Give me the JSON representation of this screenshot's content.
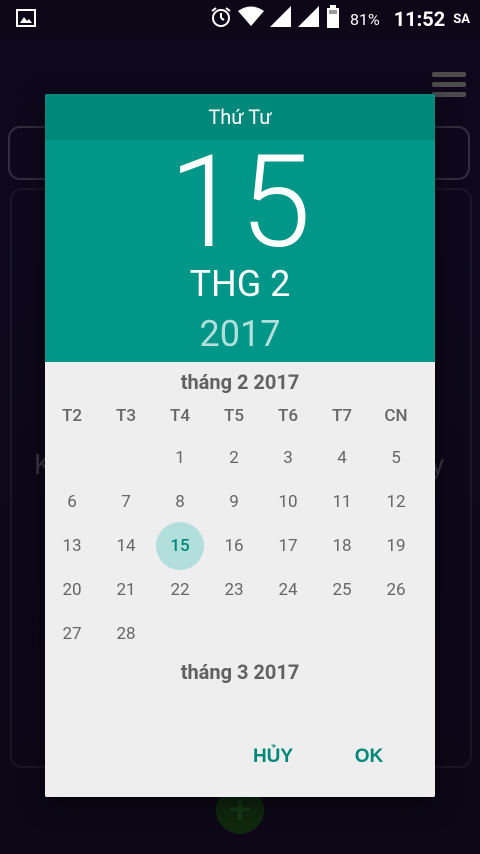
{
  "status_bar": {
    "battery": "81%",
    "time": "11:52",
    "ampm": "SA",
    "icons": [
      "image-icon",
      "alarm-icon",
      "wifi-icon",
      "signal-icon",
      "signal-icon",
      "battery-icon"
    ]
  },
  "background_app": {
    "peek_left": "K",
    "peek_right": "y",
    "fab_label": "+"
  },
  "dialog": {
    "weekday": "Thứ Tư",
    "day": "15",
    "month": "THG 2",
    "year": "2017",
    "month_title": "tháng 2 2017",
    "next_month_title": "tháng 3 2017",
    "weekday_headers": [
      "T2",
      "T3",
      "T4",
      "T5",
      "T6",
      "T7",
      "CN"
    ],
    "first_weekday_index": 2,
    "days_in_month": 28,
    "selected_day": 15,
    "cancel_label": "HỦY",
    "ok_label": "OK"
  },
  "colors": {
    "accent": "#009688",
    "accent_dark": "#00897b",
    "selected_bg": "#b2dfdb"
  }
}
